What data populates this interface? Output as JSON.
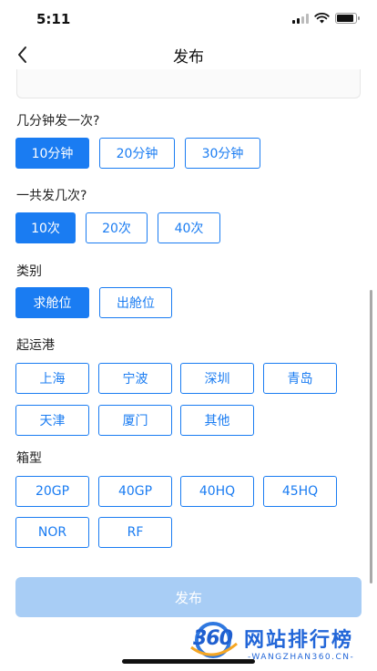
{
  "status": {
    "time": "5:11",
    "battery_level": 0.9
  },
  "nav": {
    "title": "发布"
  },
  "sections": {
    "frequency": {
      "label": "几分钟发一次?",
      "options": [
        "10分钟",
        "20分钟",
        "30分钟"
      ],
      "selected": 0
    },
    "count": {
      "label": "一共发几次?",
      "options": [
        "10次",
        "20次",
        "40次"
      ],
      "selected": 0
    },
    "category": {
      "label": "类别",
      "options": [
        "求舱位",
        "出舱位"
      ],
      "selected": 0
    },
    "port": {
      "label": "起运港",
      "options": [
        "上海",
        "宁波",
        "深圳",
        "青岛",
        "天津",
        "厦门",
        "其他"
      ],
      "selected": -1
    },
    "box": {
      "label": "箱型",
      "options": [
        "20GP",
        "40GP",
        "40HQ",
        "45HQ",
        "NOR",
        "RF"
      ],
      "selected": -1
    }
  },
  "publish": {
    "label": "发布"
  },
  "watermark": {
    "logo": "360",
    "title": "网站排行榜",
    "subtitle": "-WANGZHAN360.CN-"
  },
  "colors": {
    "accent": "#1a7cf2",
    "disabled_button": "#a8cdf5"
  },
  "icons": {
    "back": "chevron-left-icon",
    "signal": "signal-icon",
    "wifi": "wifi-icon",
    "battery": "battery-icon"
  }
}
